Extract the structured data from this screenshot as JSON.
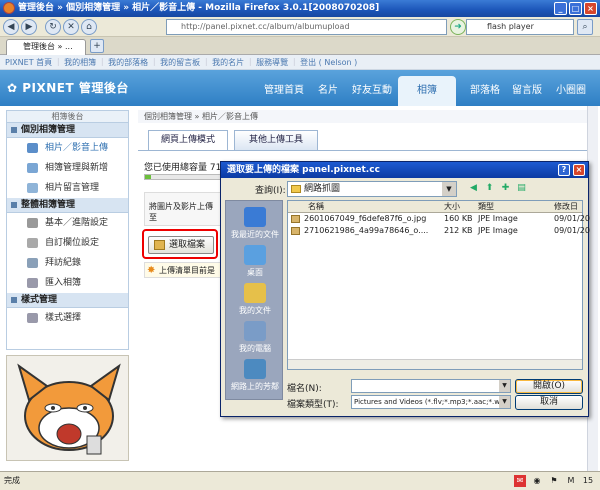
{
  "window": {
    "title": "管理後台 » 個別相簿管理 » 相片／影音上傳 - Mozilla Firefox 3.0.1[2008070208]"
  },
  "browser": {
    "url": "http://panel.pixnet.cc/album/albumupload",
    "search_value": "flash player",
    "tab_label": "管理後台 » ..."
  },
  "top_links": [
    "PIXNET 首頁",
    "｜",
    "我的相簿",
    "｜",
    "我的部落格",
    "｜",
    "我的留言板",
    "｜",
    "我的名片",
    "｜",
    "服務導覽",
    "｜",
    "登出 ( Nelson )"
  ],
  "header": {
    "logo": "PIXNET 管理後台",
    "nav": [
      "管理首頁",
      "名片",
      "好友互動",
      "相簿",
      "部落格",
      "留言版",
      "小圈圈"
    ],
    "active": "相簿"
  },
  "sidebar": {
    "heading": "相簿後台",
    "sections": [
      {
        "title": "個別相簿管理",
        "items": [
          "相片／影音上傳",
          "相簿管理與新增",
          "相片留言管理"
        ]
      },
      {
        "title": "整體相簿管理",
        "items": [
          "基本／進階設定",
          "自訂欄位設定",
          "拜訪紀錄",
          "匯入相簿"
        ]
      },
      {
        "title": "樣式管理",
        "items": [
          "樣式選擇"
        ]
      }
    ]
  },
  "main": {
    "breadcrumb": "個別相簿管理 » 相片／影音上傳",
    "tabs": [
      "網頁上傳模式",
      "其他上傳工具"
    ],
    "usage_text": "您已使用總容量 71",
    "desc_text": "將圖片及影片上傳至",
    "select_button": "選取檔案",
    "note_text": "上傳清單目前是"
  },
  "dialog": {
    "title": "選取要上傳的檔案 panel.pixnet.cc",
    "look_in_label": "查詢(I):",
    "look_in_value": "網路抓圖",
    "places": [
      "我最近的文件",
      "桌面",
      "我的文件",
      "我的電腦",
      "網路上的芳鄰"
    ],
    "columns": [
      "名稱",
      "大小",
      "類型",
      "修改日"
    ],
    "files": [
      {
        "name": "2601067049_f6defe87f6_o.jpg",
        "size": "160 KB",
        "type": "JPE Image",
        "date": "09/01/20"
      },
      {
        "name": "2710621986_4a99a78646_o....",
        "size": "212 KB",
        "type": "JPE Image",
        "date": "09/01/20"
      }
    ],
    "filename_label": "檔名(N):",
    "filename_value": "",
    "filetype_label": "檔案類型(T):",
    "filetype_value": "Pictures and Videos (*.flv;*.mp3;*.aac;*.wav;*.",
    "open_button": "開啟(O)",
    "cancel_button": "取消"
  },
  "status": {
    "text": "完成",
    "right_number": "15"
  }
}
